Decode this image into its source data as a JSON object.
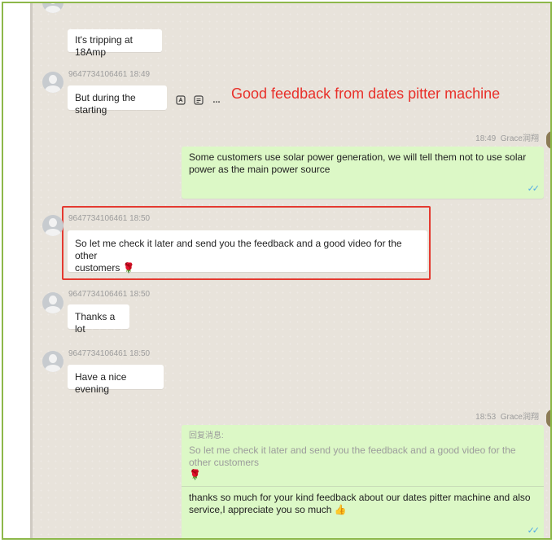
{
  "messages": [
    {
      "sender": "",
      "time": "",
      "text": "It's tripping at 18Amp"
    },
    {
      "sender": "9647734106461",
      "time": "18:49",
      "text": "But during the starting"
    },
    {
      "sender": "9647734106461",
      "time": "18:50",
      "text_line1": "So let me check it later and send you the feedback and a good video for the other",
      "text_line2": "customers",
      "emoji": "🌹"
    },
    {
      "sender": "9647734106461",
      "time": "18:50",
      "text": "Thanks a lot"
    },
    {
      "sender": "9647734106461",
      "time": "18:50",
      "text": "Have a nice evening"
    }
  ],
  "outgoing": [
    {
      "time": "18:49",
      "sender": "Grace润翔",
      "text": "Some customers use solar power generation, we will tell them not to use solar power as the main power source",
      "ticks": "✓✓"
    },
    {
      "time": "18:53",
      "sender": "Grace润翔",
      "quote_label": "回复消息:",
      "quote_text": "So let me check it later and send you the feedback and a good video for the other customers",
      "quote_emoji": "🌹",
      "text": "thanks so much for your kind feedback about our dates pitter machine and also service,I appreciate you so much",
      "emoji": "👍",
      "ticks": "✓✓"
    }
  ],
  "hover_tools": {
    "icons": [
      "translate-icon",
      "quote-icon",
      "more-icon"
    ],
    "more_label": "..."
  },
  "annotation": {
    "text": "Good feedback from dates pitter machine",
    "color": "#e8302a"
  },
  "colors": {
    "incoming_bubble": "#ffffff",
    "outgoing_bubble": "#dcf8c6",
    "frame": "#8db84a",
    "highlight": "#e43a30"
  }
}
